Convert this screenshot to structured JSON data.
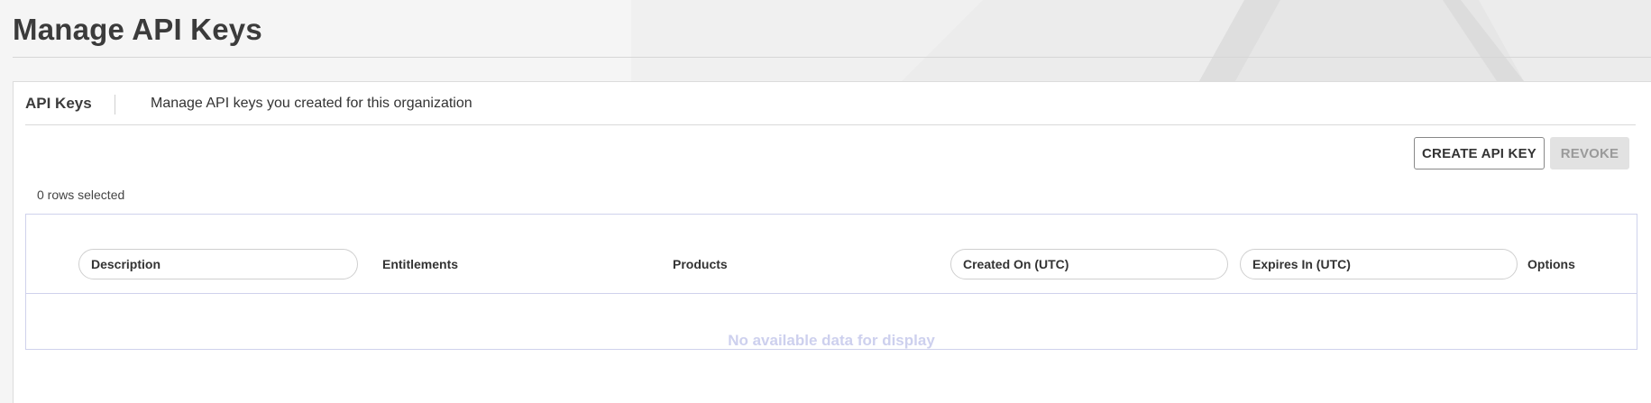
{
  "page": {
    "title": "Manage API Keys"
  },
  "panel": {
    "title": "API Keys",
    "description": "Manage API keys you created for this organization"
  },
  "toolbar": {
    "create_label": "CREATE API KEY",
    "revoke_label": "REVOKE",
    "revoke_enabled": false
  },
  "selection": {
    "status": "0 rows selected"
  },
  "table": {
    "columns": [
      {
        "label": "Description",
        "filterable": true
      },
      {
        "label": "Entitlements",
        "filterable": false
      },
      {
        "label": "Products",
        "filterable": false
      },
      {
        "label": "Created On (UTC)",
        "filterable": true
      },
      {
        "label": "Expires In (UTC)",
        "filterable": true
      },
      {
        "label": "Options",
        "filterable": false
      }
    ],
    "rows": [],
    "empty_message": "No available data for display"
  },
  "colors": {
    "background": "#f4f4f4",
    "panel": "#ffffff",
    "grid_border": "#cfd2ec",
    "empty_text": "#cdd0ee",
    "revoke_disabled_bg": "#e2e2e2"
  }
}
